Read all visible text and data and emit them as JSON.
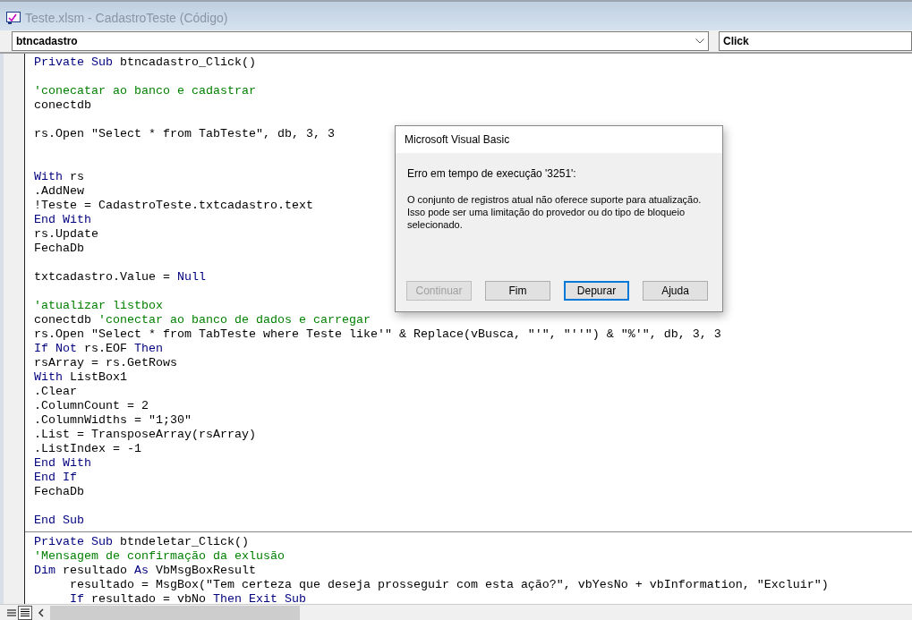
{
  "window": {
    "title": "Teste.xlsm - CadastroTeste (Código)"
  },
  "object_combo": {
    "value": "btncadastro"
  },
  "procedure_combo": {
    "value": "Click"
  },
  "procedures": [
    {
      "blocks": [
        {
          "lines": [
            {
              "tokens": [
                {
                  "kind": "keyword",
                  "text": "Private Sub"
                },
                {
                  "kind": "plain",
                  "text": " btncadastro_Click()"
                }
              ]
            }
          ]
        },
        {
          "lines": [
            {
              "tokens": [
                {
                  "kind": "comment",
                  "text": "'conecatar ao banco e cadastrar"
                }
              ]
            },
            {
              "tokens": [
                {
                  "kind": "plain",
                  "text": "conectdb"
                }
              ]
            }
          ]
        },
        {
          "lines": [
            {
              "tokens": [
                {
                  "kind": "plain",
                  "text": "rs.Open \"Select * from TabTeste\", db, 3, 3"
                }
              ]
            }
          ]
        },
        {
          "lines": [
            {
              "tokens": [
                {
                  "kind": "keyword",
                  "text": "With"
                },
                {
                  "kind": "plain",
                  "text": " rs"
                }
              ]
            },
            {
              "tokens": [
                {
                  "kind": "plain",
                  "text": ".AddNew"
                }
              ]
            },
            {
              "tokens": [
                {
                  "kind": "plain",
                  "text": "!Teste = CadastroTeste.txtcadastro.text"
                }
              ]
            },
            {
              "tokens": [
                {
                  "kind": "keyword",
                  "text": "End With"
                }
              ]
            },
            {
              "tokens": [
                {
                  "kind": "plain",
                  "text": "rs.Update"
                }
              ]
            },
            {
              "tokens": [
                {
                  "kind": "plain",
                  "text": "FechaDb"
                }
              ]
            }
          ]
        },
        {
          "lines": [
            {
              "tokens": [
                {
                  "kind": "plain",
                  "text": "txtcadastro.Value = "
                },
                {
                  "kind": "keyword",
                  "text": "Null"
                }
              ]
            }
          ]
        },
        {
          "lines": [
            {
              "tokens": [
                {
                  "kind": "comment",
                  "text": "'atualizar listbox"
                }
              ]
            },
            {
              "tokens": [
                {
                  "kind": "plain",
                  "text": "conectdb "
                },
                {
                  "kind": "comment",
                  "text": "'conectar ao banco de dados e carregar"
                }
              ]
            },
            {
              "tokens": [
                {
                  "kind": "plain",
                  "text": "rs.Open \"Select * from TabTeste where Teste like'\" & Replace(vBusca, \"'\", \"''\") & \"%'\", db, 3, 3"
                }
              ]
            },
            {
              "tokens": [
                {
                  "kind": "keyword",
                  "text": "If Not"
                },
                {
                  "kind": "plain",
                  "text": " rs.EOF "
                },
                {
                  "kind": "keyword",
                  "text": "Then"
                }
              ]
            },
            {
              "tokens": [
                {
                  "kind": "plain",
                  "text": "rsArray = rs.GetRows"
                }
              ]
            },
            {
              "tokens": [
                {
                  "kind": "keyword",
                  "text": "With"
                },
                {
                  "kind": "plain",
                  "text": " ListBox1"
                }
              ]
            },
            {
              "tokens": [
                {
                  "kind": "plain",
                  "text": ".Clear"
                }
              ]
            },
            {
              "tokens": [
                {
                  "kind": "plain",
                  "text": ".ColumnCount = 2"
                }
              ]
            },
            {
              "tokens": [
                {
                  "kind": "plain",
                  "text": ".ColumnWidths = \"1;30\""
                }
              ]
            },
            {
              "tokens": [
                {
                  "kind": "plain",
                  "text": ".List = TransposeArray(rsArray)"
                }
              ]
            },
            {
              "tokens": [
                {
                  "kind": "plain",
                  "text": ".ListIndex = -1"
                }
              ]
            },
            {
              "tokens": [
                {
                  "kind": "keyword",
                  "text": "End With"
                }
              ]
            },
            {
              "tokens": [
                {
                  "kind": "keyword",
                  "text": "End If"
                }
              ]
            },
            {
              "tokens": [
                {
                  "kind": "plain",
                  "text": "FechaDb"
                }
              ]
            }
          ]
        },
        {
          "lines": [
            {
              "tokens": [
                {
                  "kind": "keyword",
                  "text": "End Sub"
                }
              ]
            }
          ]
        }
      ]
    },
    {
      "blocks": [
        {
          "lines": [
            {
              "tokens": [
                {
                  "kind": "keyword",
                  "text": "Private Sub"
                },
                {
                  "kind": "plain",
                  "text": " btndeletar_Click()"
                }
              ]
            },
            {
              "tokens": [
                {
                  "kind": "comment",
                  "text": "'Mensagem de confirmação da exlusão"
                }
              ]
            },
            {
              "tokens": [
                {
                  "kind": "keyword",
                  "text": "Dim"
                },
                {
                  "kind": "plain",
                  "text": " resultado "
                },
                {
                  "kind": "keyword",
                  "text": "As"
                },
                {
                  "kind": "plain",
                  "text": " VbMsgBoxResult"
                }
              ]
            },
            {
              "tokens": [
                {
                  "kind": "plain",
                  "text": "     resultado = MsgBox(\"Tem certeza que deseja prosseguir com esta ação?\", vbYesNo + vbInformation, \"Excluir\")"
                }
              ]
            },
            {
              "tokens": [
                {
                  "kind": "keyword",
                  "text": "     If"
                },
                {
                  "kind": "plain",
                  "text": " resultado = vbNo "
                },
                {
                  "kind": "keyword",
                  "text": "Then Exit Sub"
                }
              ]
            }
          ]
        }
      ]
    }
  ],
  "dialog": {
    "title": "Microsoft Visual Basic",
    "error_line": "Erro em tempo de execução '3251':",
    "message": "O conjunto de registros atual não oferece suporte para atualização. Isso pode ser uma limitação do provedor ou do tipo de bloqueio selecionado.",
    "buttons": [
      {
        "label": "Continuar",
        "disabled": true,
        "focused": false
      },
      {
        "label": "Fim",
        "disabled": false,
        "focused": false
      },
      {
        "label": "Depurar",
        "disabled": false,
        "focused": true
      },
      {
        "label": "Ajuda",
        "disabled": false,
        "focused": false
      }
    ]
  }
}
